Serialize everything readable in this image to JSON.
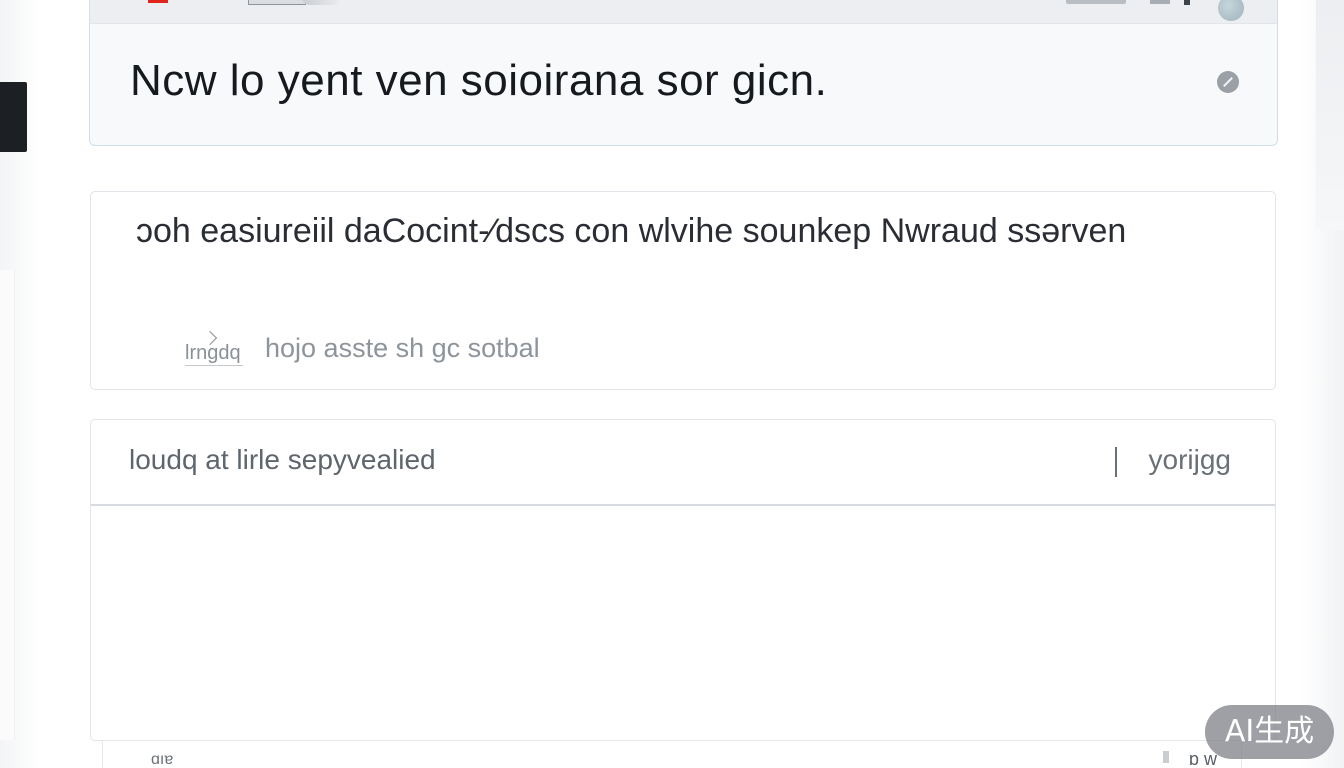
{
  "header": {
    "title": "Ncw lo yent ven soioirana sor gicn."
  },
  "description": {
    "text": "ɔoh easiureiil daCocint-∕dscs con wlvihe sounkep Nwraud ssərven",
    "meta_icon_label": "lrngdq",
    "meta_text": "hojo asste sh gc sotbal"
  },
  "list_panel": {
    "header_label": "loudq at lirle sepyvealied",
    "header_action": "yorijgg"
  },
  "bottom_bar": {
    "left_text": "ɑıɐ",
    "right_text": "ɒ w"
  },
  "badge": {
    "label": "AI生成"
  },
  "colors": {
    "accent_red": "#e0241c",
    "header_border": "#cfe0ea",
    "text_primary": "#16191d",
    "text_muted": "#8e949b"
  }
}
